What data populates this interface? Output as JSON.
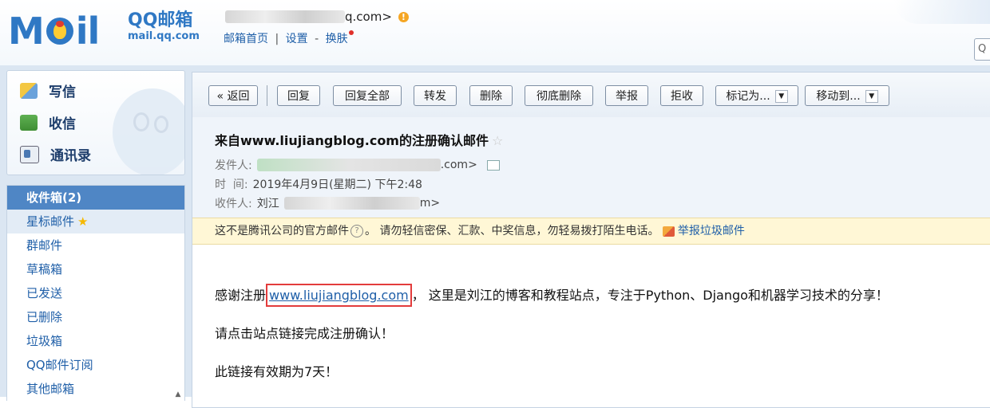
{
  "header": {
    "logo_mail": "M",
    "logo_il": "il",
    "logo_cn": "QQ邮箱",
    "logo_en": "mail.qq.com",
    "account_suffix": "q.com>",
    "links": [
      "邮箱首页",
      "设置",
      "换肤"
    ],
    "sep1": "|",
    "sep2": "-",
    "search_glyph": "Q"
  },
  "sidebar": {
    "quick": [
      {
        "label": "写信",
        "icon": "pencil-icon"
      },
      {
        "label": "收信",
        "icon": "inbox-icon"
      },
      {
        "label": "通讯录",
        "icon": "contacts-icon"
      }
    ],
    "folders": [
      {
        "label": "收件箱(2)",
        "state": "active"
      },
      {
        "label": "星标邮件",
        "state": "light",
        "star": "★"
      },
      {
        "label": "群邮件"
      },
      {
        "label": "草稿箱"
      },
      {
        "label": "已发送"
      },
      {
        "label": "已删除"
      },
      {
        "label": "垃圾箱"
      },
      {
        "label": "QQ邮件订阅"
      },
      {
        "label": "其他邮箱"
      }
    ]
  },
  "toolbar": {
    "back": "« 返回",
    "reply": "回复",
    "reply_all": "回复全部",
    "forward": "转发",
    "delete": "删除",
    "delete_forever": "彻底删除",
    "report": "举报",
    "reject": "拒收",
    "mark_as": "标记为...",
    "move_to": "移动到...",
    "caret": "▼"
  },
  "message": {
    "subject": "来自www.liujiangblog.com的注册确认邮件",
    "star": "☆",
    "from_label": "发件人:",
    "from_suffix": ".com>",
    "time_label": "时  间:",
    "time_value": "2019年4月9日(星期二) 下午2:48",
    "to_label": "收件人:",
    "to_name": "刘江",
    "to_suffix": "m>",
    "notice": "这不是腾讯公司的官方邮件",
    "notice_q": "?",
    "notice_tail": "。 请勿轻信密保、汇款、中奖信息，勿轻易拨打陌生电话。",
    "report_spam": "举报垃圾邮件",
    "body": {
      "line1_pre": "感谢注册",
      "line1_link": "www.liujiangblog.com",
      "line1_post": "，  这里是刘江的博客和教程站点，专注于Python、Django和机器学习技术的分享！",
      "line2": "请点击站点链接完成注册确认！",
      "line3": "此链接有效期为7天！"
    }
  }
}
